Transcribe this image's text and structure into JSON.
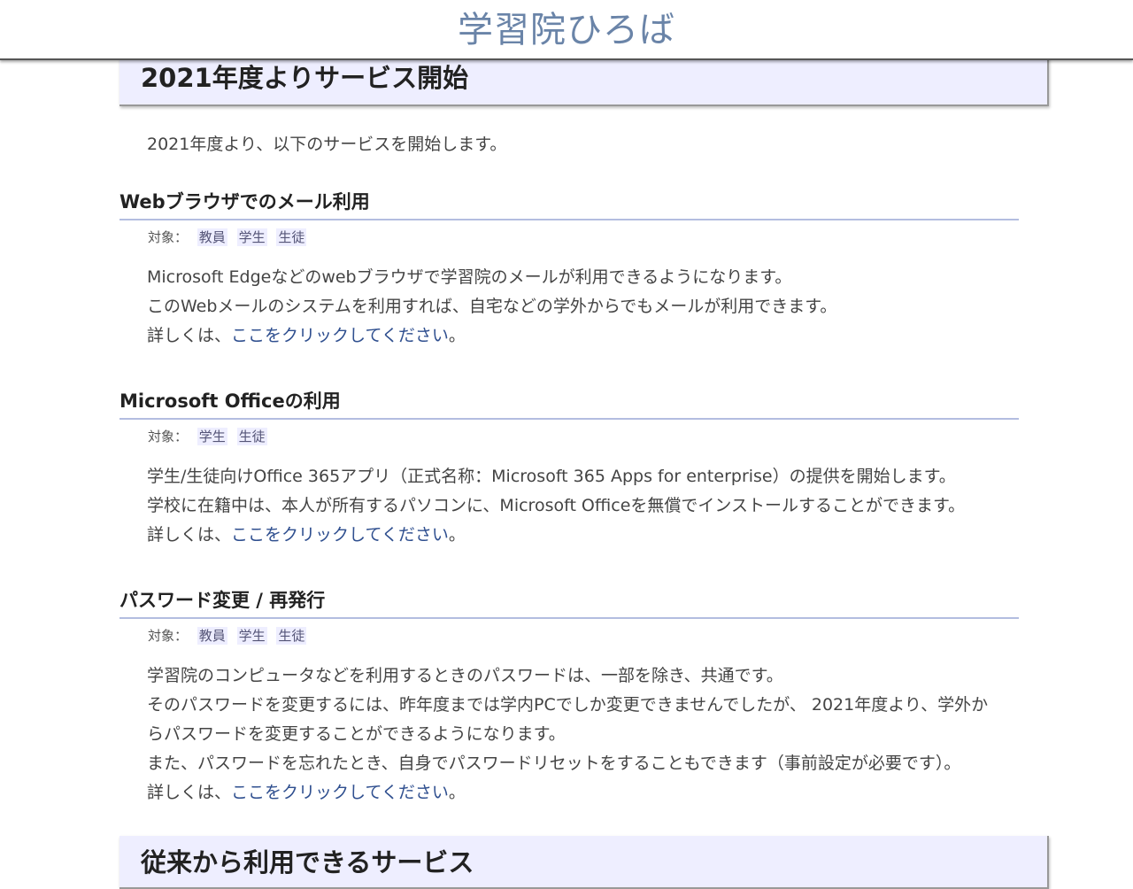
{
  "site": {
    "title": "学習院ひろば"
  },
  "section1": {
    "title": "2021年度よりサービス開始",
    "intro": "2021年度より、以下のサービスを開始します。"
  },
  "services": [
    {
      "title": "Webブラウザでのメール利用",
      "target_label": "対象：",
      "targets": [
        "教員",
        "学生",
        "生徒"
      ],
      "lines": [
        "Microsoft Edgeなどのwebブラウザで学習院のメールが利用できるようになります。",
        "このWebメールのシステムを利用すれば、自宅などの学外からでもメールが利用できます。"
      ],
      "details_prefix": "詳しくは、",
      "details_link": "ここをクリックしてください",
      "details_suffix": "。"
    },
    {
      "title": "Microsoft Officeの利用",
      "target_label": "対象：",
      "targets": [
        "学生",
        "生徒"
      ],
      "lines": [
        "学生/生徒向けOffice 365アプリ（正式名称：Microsoft 365 Apps for enterprise）の提供を開始します。",
        "学校に在籍中は、本人が所有するパソコンに、Microsoft Officeを無償でインストールすることができます。"
      ],
      "details_prefix": "詳しくは、",
      "details_link": "ここをクリックしてください",
      "details_suffix": "。"
    },
    {
      "title": "パスワード変更 / 再発行",
      "target_label": "対象：",
      "targets": [
        "教員",
        "学生",
        "生徒"
      ],
      "lines": [
        "学習院のコンピュータなどを利用するときのパスワードは、一部を除き、共通です。",
        "そのパスワードを変更するには、昨年度までは学内PCでしか変更できませんでしたが、 2021年度より、学外か",
        "らパスワードを変更することができるようになります。",
        "また、パスワードを忘れたとき、自身でパスワードリセットをすることもできます（事前設定が必要です）。"
      ],
      "details_prefix": "詳しくは、",
      "details_link": "ここをクリックしてください",
      "details_suffix": "。"
    }
  ],
  "section2": {
    "title": "従来から利用できるサービス"
  },
  "colors": {
    "title": "#6a84a8",
    "header_bg": "#eeeeff",
    "underline": "#b3bde0",
    "link": "#2f4f8f"
  }
}
